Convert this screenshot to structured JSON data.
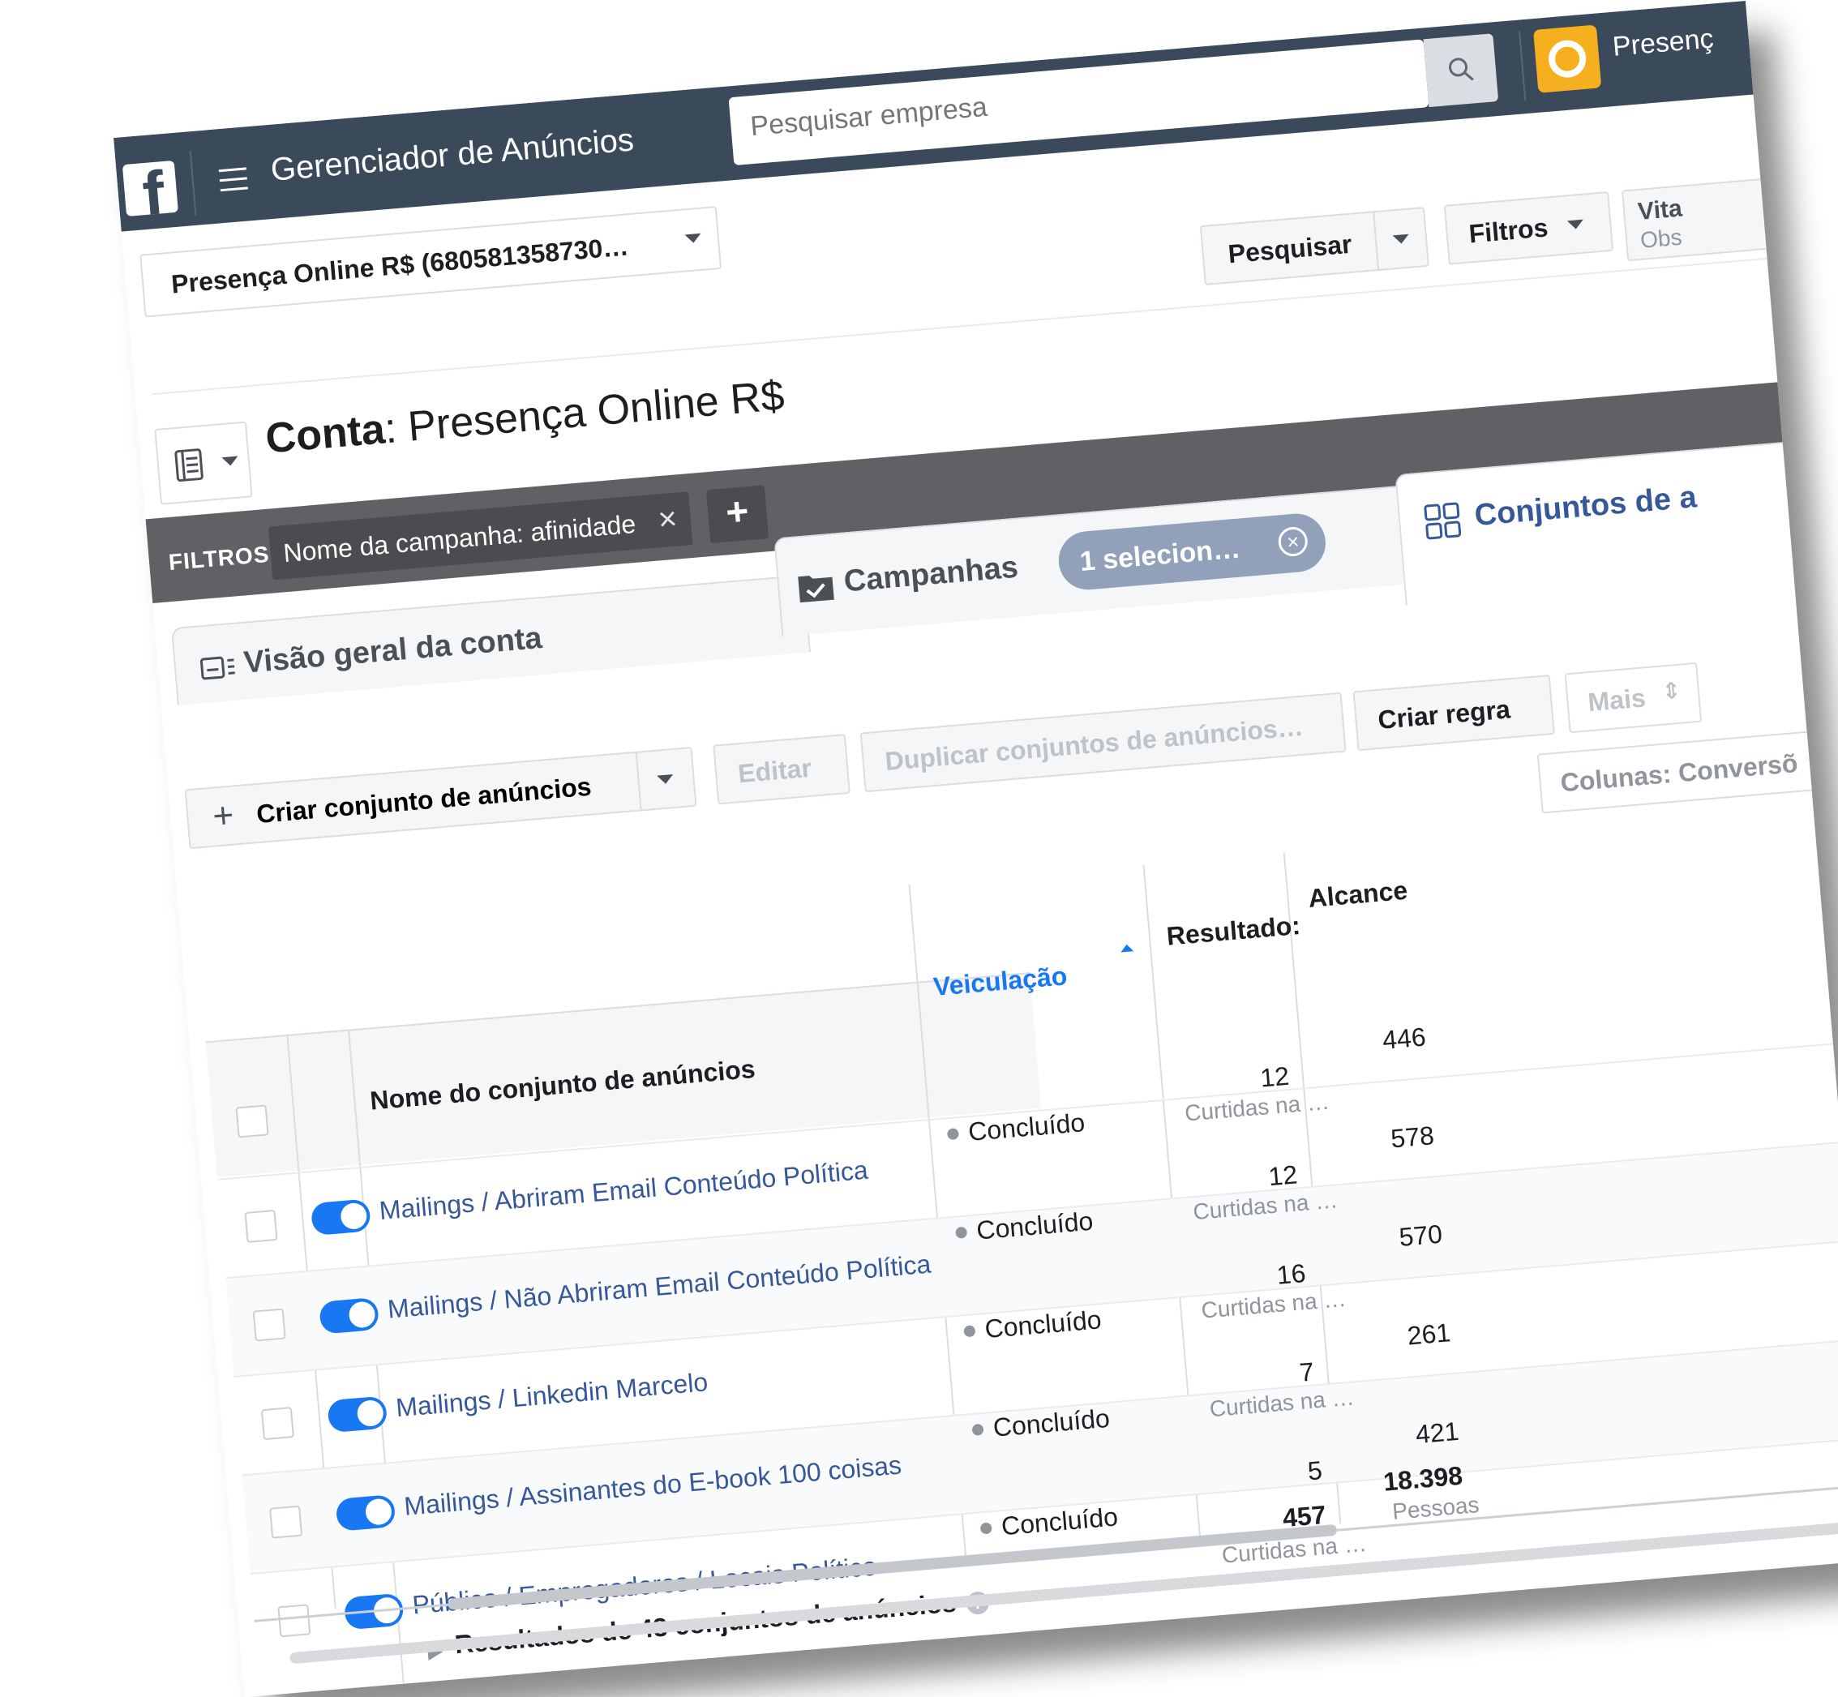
{
  "topbar": {
    "app_title": "Gerenciador de Anúncios",
    "search_placeholder": "Pesquisar empresa",
    "brand_name": "Presenç"
  },
  "account": {
    "selector_label": "Presença Online R$ (680581358730…",
    "title_prefix": "Conta",
    "title_name": ": Presença Online R$"
  },
  "controls": {
    "search_label": "Pesquisar",
    "filters_label": "Filtros",
    "vita_line1": "Vita",
    "vita_line2": "Obs"
  },
  "filters": {
    "label": "FILTROS:",
    "chip": "Nome da campanha:  afinidade",
    "add": "+"
  },
  "tabs": {
    "overview": "Visão geral da conta",
    "campaigns": "Campanhas",
    "selected_chip": "1 selecion…",
    "adsets": "Conjuntos de a"
  },
  "toolbar": {
    "create": "Criar conjunto de anúncios",
    "edit": "Editar",
    "duplicate": "Duplicar conjuntos de anúncios…",
    "rule": "Criar regra",
    "more": "Mais",
    "columns": "Colunas: Conversõ"
  },
  "table": {
    "headers": {
      "name": "Nome do conjunto de anúncios",
      "delivery": "Veiculação",
      "results": "Resultado:",
      "reach": "Alcance"
    },
    "rows": [
      {
        "name": "Mailings / Abriram Email Conteúdo Política",
        "status": "Concluído",
        "results": "12",
        "results_sub": "Curtidas na …",
        "reach": "446"
      },
      {
        "name": "Mailings / Não Abriram Email Conteúdo Política",
        "status": "Concluído",
        "results": "12",
        "results_sub": "Curtidas na …",
        "reach": "578"
      },
      {
        "name": "Mailings / Linkedin Marcelo",
        "status": "Concluído",
        "results": "16",
        "results_sub": "Curtidas na …",
        "reach": "570"
      },
      {
        "name": "Mailings / Assinantes do E-book 100 coisas",
        "status": "Concluído",
        "results": "7",
        "results_sub": "Curtidas na …",
        "reach": "261"
      },
      {
        "name": "Público / Empregadores / Locais Político",
        "status": "Concluído",
        "results": "5",
        "results_sub": "",
        "reach": "421"
      }
    ],
    "summary": {
      "label": "Resultados de 43 conjuntos de anúncios",
      "results": "457",
      "results_sub": "Curtidas na …",
      "reach": "18.398",
      "reach_sub": "Pessoas"
    }
  },
  "colors": {
    "topbar": "#3b4a5a",
    "link": "#365899",
    "toggle": "#1877f2",
    "filters_bar": "#5f6164"
  }
}
